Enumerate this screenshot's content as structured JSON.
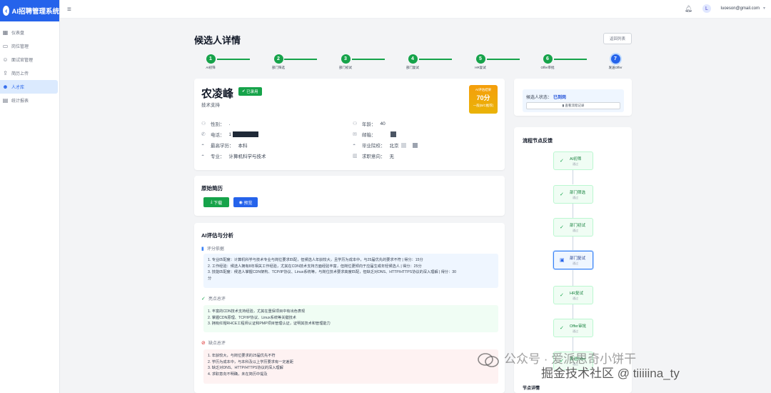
{
  "app": {
    "title": "AI招聘管理系统"
  },
  "sidebar": {
    "items": [
      {
        "label": "仪表盘",
        "icon": "dashboard-icon"
      },
      {
        "label": "岗位管理",
        "icon": "briefcase-icon"
      },
      {
        "label": "面试官管理",
        "icon": "user-tie-icon"
      },
      {
        "label": "简历上传",
        "icon": "upload-icon"
      },
      {
        "label": "人才库",
        "icon": "users-icon"
      },
      {
        "label": "统计报表",
        "icon": "chart-icon"
      }
    ],
    "active_index": 4
  },
  "topbar": {
    "email": "luoeson@gmail.com",
    "avatar_letter": "L"
  },
  "page": {
    "title": "候选人详情",
    "back_label": "返回列表"
  },
  "steps": [
    {
      "num": "1",
      "label": "AI初筛"
    },
    {
      "num": "2",
      "label": "部门筛选"
    },
    {
      "num": "3",
      "label": "部门初试"
    },
    {
      "num": "4",
      "label": "部门复试"
    },
    {
      "num": "5",
      "label": "HR复试"
    },
    {
      "num": "6",
      "label": "Offer审批"
    },
    {
      "num": "7",
      "label": "发送Offer"
    }
  ],
  "candidate": {
    "name": "农凌峰",
    "status_badge": "已录用",
    "position": "技术支持",
    "score_label": "AI评估结果",
    "score": "70分",
    "score_level": "一般(B/C推荐)",
    "fields": {
      "gender_label": "性别：",
      "gender": ".",
      "age_label": "年龄：",
      "age": "40",
      "phone_label": "电话：",
      "phone": "1",
      "email_label": "邮箱：",
      "edu_label": "最高学历：",
      "edu": "本科",
      "school_label": "毕业院校：",
      "school": "北京",
      "major_label": "专业：",
      "major": "计算机科学与技术",
      "intent_label": "求职意向：",
      "intent": "无"
    }
  },
  "resume": {
    "title": "原始简历",
    "download_label": "下载",
    "preview_label": "预览"
  },
  "ai": {
    "title": "AI评估与分析",
    "basis_title": "评分依据",
    "basis": [
      "1. 专业匹配度：计算机科学与技术专业与岗位要求匹配，但候选人年龄较大，且学历为成本中，与25届优先的要求不符 | 得分：15分",
      "2. 工作经验：候选人拥有8年相关工作经验，尤其在CDN技术支持方面经验丰富，但岗位更倾向于应届生或年轻候选人 | 得分：25分",
      "3. 技能匹配度：候选人掌握CDN架构、TCP/IP协议、Linux系统等，与岗位技术要求高度匹配，但缺乏对DNS、HTTP/HTTPS协议的深入理解 | 得分：30",
      "分"
    ],
    "pros_title": "亮点总评",
    "pros": [
      "1. 丰富的CDN技术支持经验，尤其在重保项目中有出色表现",
      "2. 掌握CDN原理、TCP/IP协议、Linux系统等关键技术",
      "3. 拥有红帽RHCE工程师认证和PMP项目管理认证，证明其技术和管理能力"
    ],
    "cons_title": "缺点总评",
    "cons": [
      "1. 年龄较大，与岗位要求的25届优先不符",
      "2. 学历为成本中，与本科及以上学历要求有一定差距",
      "3. 缺乏对DNS、HTTP/HTTPS协议的深入理解",
      "4. 求职意向不明确，未在简历中提及"
    ]
  },
  "status_card": {
    "label": "候选人状态：",
    "value": "已到岗",
    "button": "查看流程记录"
  },
  "flow": {
    "title": "流程节点反馈",
    "nodes": [
      {
        "name": "AI初筛",
        "state": "通过"
      },
      {
        "name": "部门筛选",
        "state": "通过"
      },
      {
        "name": "部门初试",
        "state": "通过"
      },
      {
        "name": "部门复试",
        "state": "通过"
      },
      {
        "name": "HR复试",
        "state": "通过"
      },
      {
        "name": "Offer审批",
        "state": "通过"
      },
      {
        "name": "发送Offer",
        "state": "通过"
      }
    ],
    "detail_title": "节点详情"
  },
  "watermark": {
    "line1": "公众号 · 爱派思奇小饼干",
    "line2": "掘金技术社区 @ tiiiiina_ty"
  }
}
